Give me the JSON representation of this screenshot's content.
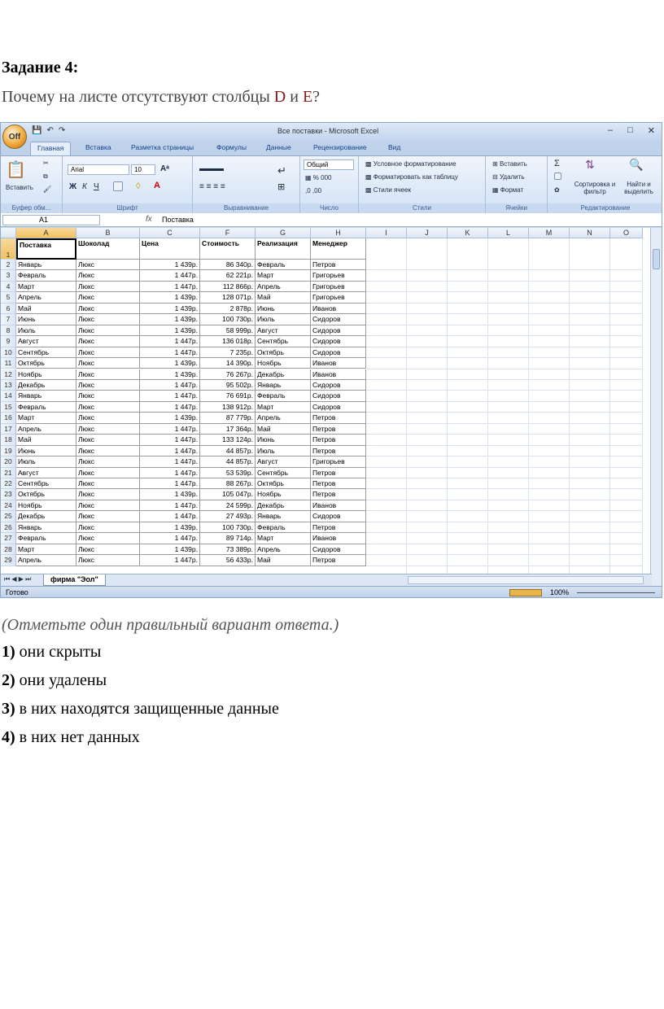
{
  "question": {
    "title": "Задание 4:",
    "text_before": "Почему на листе отсутствуют столбцы ",
    "col_d": "D",
    "mid": " и ",
    "col_e": "E",
    "text_after": "?"
  },
  "excel": {
    "app_title": "Все поставки - Microsoft Excel",
    "tabs": [
      "Главная",
      "Вставка",
      "Разметка страницы",
      "Формулы",
      "Данные",
      "Рецензирование",
      "Вид"
    ],
    "groups": [
      "Буфер обм...",
      "Шрифт",
      "Выравнивание",
      "Число",
      "Стили",
      "Ячейки",
      "Редактирование"
    ],
    "paste": "Вставить",
    "font_name": "Arial",
    "font_size": "10",
    "number_format": "Общий",
    "styles": [
      "Условное форматирование",
      "Форматировать как таблицу",
      "Стили ячеек"
    ],
    "cells_btns": [
      "Вставить",
      "Удалить",
      "Формат"
    ],
    "sort": "Сортировка и фильтр",
    "find": "Найти и выделить",
    "name_box": "A1",
    "fx": "fx",
    "formula": "Поставка",
    "columns": [
      "A",
      "B",
      "C",
      "F",
      "G",
      "H",
      "I",
      "J",
      "K",
      "L",
      "M",
      "N",
      "O"
    ],
    "headers": [
      "Поставка",
      "Шоколад",
      "Цена",
      "Стоимость",
      "Реализация",
      "Менеджер"
    ],
    "rows": [
      [
        "Январь",
        "Люкс",
        "1 439р.",
        "86 340р.",
        "Февраль",
        "Петров"
      ],
      [
        "Февраль",
        "Люкс",
        "1 447р.",
        "62 221р.",
        "Март",
        "Григорьев"
      ],
      [
        "Март",
        "Люкс",
        "1 447р.",
        "112 866р.",
        "Апрель",
        "Григорьев"
      ],
      [
        "Апрель",
        "Люкс",
        "1 439р.",
        "128 071р.",
        "Май",
        "Григорьев"
      ],
      [
        "Май",
        "Люкс",
        "1 439р.",
        "2 878р.",
        "Июнь",
        "Иванов"
      ],
      [
        "Июнь",
        "Люкс",
        "1 439р.",
        "100 730р.",
        "Июль",
        "Сидоров"
      ],
      [
        "Июль",
        "Люкс",
        "1 439р.",
        "58 999р.",
        "Август",
        "Сидоров"
      ],
      [
        "Август",
        "Люкс",
        "1 447р.",
        "136 018р.",
        "Сентябрь",
        "Сидоров"
      ],
      [
        "Сентябрь",
        "Люкс",
        "1 447р.",
        "7 235р.",
        "Октябрь",
        "Сидоров"
      ],
      [
        "Октябрь",
        "Люкс",
        "1 439р.",
        "14 390р.",
        "Ноябрь",
        "Иванов"
      ],
      [
        "Ноябрь",
        "Люкс",
        "1 439р.",
        "76 267р.",
        "Декабрь",
        "Иванов"
      ],
      [
        "Декабрь",
        "Люкс",
        "1 447р.",
        "95 502р.",
        "Январь",
        "Сидоров"
      ],
      [
        "Январь",
        "Люкс",
        "1 447р.",
        "76 691р.",
        "Февраль",
        "Сидоров"
      ],
      [
        "Февраль",
        "Люкс",
        "1 447р.",
        "138 912р.",
        "Март",
        "Сидоров"
      ],
      [
        "Март",
        "Люкс",
        "1 439р.",
        "87 779р.",
        "Апрель",
        "Петров"
      ],
      [
        "Апрель",
        "Люкс",
        "1 447р.",
        "17 364р.",
        "Май",
        "Петров"
      ],
      [
        "Май",
        "Люкс",
        "1 447р.",
        "133 124р.",
        "Июнь",
        "Петров"
      ],
      [
        "Июнь",
        "Люкс",
        "1 447р.",
        "44 857р.",
        "Июль",
        "Петров"
      ],
      [
        "Июль",
        "Люкс",
        "1 447р.",
        "44 857р.",
        "Август",
        "Григорьев"
      ],
      [
        "Август",
        "Люкс",
        "1 447р.",
        "53 539р.",
        "Сентябрь",
        "Петров"
      ],
      [
        "Сентябрь",
        "Люкс",
        "1 447р.",
        "88 267р.",
        "Октябрь",
        "Петров"
      ],
      [
        "Октябрь",
        "Люкс",
        "1 439р.",
        "105 047р.",
        "Ноябрь",
        "Петров"
      ],
      [
        "Ноябрь",
        "Люкс",
        "1 447р.",
        "24 599р.",
        "Декабрь",
        "Иванов"
      ],
      [
        "Декабрь",
        "Люкс",
        "1 447р.",
        "27 493р.",
        "Январь",
        "Сидоров"
      ],
      [
        "Январь",
        "Люкс",
        "1 439р.",
        "100 730р.",
        "Февраль",
        "Петров"
      ],
      [
        "Февраль",
        "Люкс",
        "1 447р.",
        "89 714р.",
        "Март",
        "Иванов"
      ],
      [
        "Март",
        "Люкс",
        "1 439р.",
        "73 389р.",
        "Апрель",
        "Сидоров"
      ],
      [
        "Апрель",
        "Люкс",
        "1 447р.",
        "56 433р.",
        "Май",
        "Петров"
      ]
    ],
    "sheet_tab": "фирма \"Эол\"",
    "status_ready": "Готово",
    "zoom": "100%"
  },
  "instruction": "(Отметьте один правильный вариант ответа.)",
  "options": [
    {
      "num": "1)",
      "text": " они скрыты"
    },
    {
      "num": "2)",
      "text": " они удалены"
    },
    {
      "num": "3)",
      "text": " в них находятся защищенные данные"
    },
    {
      "num": "4)",
      "text": " в них нет данных"
    }
  ]
}
